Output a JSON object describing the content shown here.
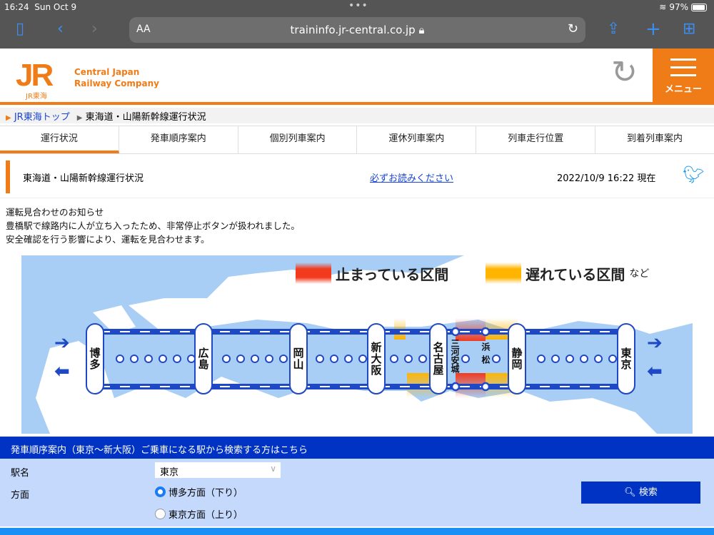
{
  "status": {
    "time": "16:24",
    "date": "Sun Oct 9",
    "battery": "97%"
  },
  "browser": {
    "aa": "AA",
    "url": "traininfo.jr-central.co.jp"
  },
  "header": {
    "logo": "JR",
    "logo_sub": "JR東海",
    "company_line1": "Central Japan",
    "company_line2": "Railway Company",
    "menu_label": "メニュー"
  },
  "breadcrumb": {
    "home": "JR東海トップ",
    "current": "東海道・山陽新幹線運行状況"
  },
  "tabs": [
    "運行状況",
    "発車順序案内",
    "個別列車案内",
    "運休列車案内",
    "列車走行位置",
    "到着列車案内"
  ],
  "title": {
    "text": "東海道・山陽新幹線運行状況",
    "must_read": "必ずお読みください",
    "timestamp": "2022/10/9 16:22 現在"
  },
  "notice": [
    "運転見合わせのお知らせ",
    "豊橋駅で線路内に人が立ち入ったため、非常停止ボタンが扱われました。",
    "安全確認を行う影響により、運転を見合わせます。"
  ],
  "map": {
    "legend_stopped": "止まっている区間",
    "legend_delayed": "遅れている区間",
    "legend_etc": "など",
    "colors": {
      "stopped": "#f23a1d",
      "delayed": "#ffb400",
      "line": "#1f48c4"
    },
    "stations": [
      "博多",
      "広島",
      "岡山",
      "新大阪",
      "名古屋",
      "三河安城",
      "浜松",
      "静岡",
      "東京"
    ]
  },
  "form": {
    "header": "発車順序案内（東京〜新大阪）ご乗車になる駅から検索する方はこちら",
    "station_label": "駅名",
    "station_value": "東京",
    "direction_label": "方面",
    "dir_down": "博多方面（下り）",
    "dir_up": "東京方面（上り）",
    "search": "検索",
    "selected_direction": "down"
  }
}
